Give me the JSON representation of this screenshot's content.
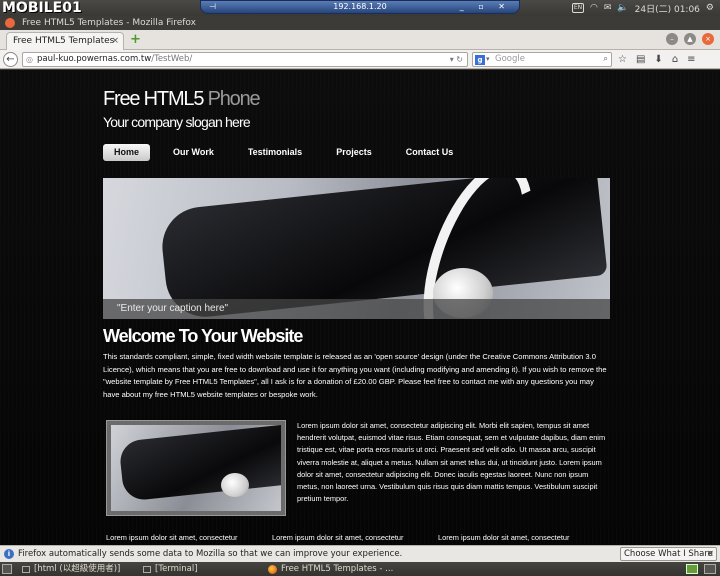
{
  "top_panel": {
    "brand": "MOBILE01",
    "vnc_address": "192.168.1.20",
    "clock": "24日(二) 01:06",
    "kb_label": "EN"
  },
  "window": {
    "title": "Free HTML5 Templates - Mozilla Firefox"
  },
  "tabs": [
    {
      "label": "Free HTML5 Templates",
      "close": "×"
    }
  ],
  "new_tab_label": "+",
  "nav": {
    "url_host": "paul-kuo.powernas.com.tw",
    "url_path": "/TestWeb/",
    "search_placeholder": "Google"
  },
  "site": {
    "logo_main": "Free HTML5",
    "logo_accent": " Phone",
    "slogan": "Your company slogan here",
    "menu": [
      {
        "label": "Home",
        "active": true
      },
      {
        "label": "Our Work",
        "active": false
      },
      {
        "label": "Testimonials",
        "active": false
      },
      {
        "label": "Projects",
        "active": false
      },
      {
        "label": "Contact Us",
        "active": false
      }
    ],
    "banner_caption": "\"Enter your caption here\"",
    "welcome_title": "Welcome To Your Website",
    "intro_text": "This standards compliant, simple, fixed width website template is released as an 'open source' design (under the Creative Commons Attribution 3.0 Licence), which means that you are free to download and use it for anything you want (including modifying and amending it). If you wish to remove the \"website template by Free HTML5 Templates\", all I ask is for a donation of £20.00 GBP. Please feel free to contact me with any questions you may have about my free HTML5 website templates or bespoke work.",
    "side_text": "Lorem ipsum dolor sit amet, consectetur adipiscing elit. Morbi elit sapien, tempus sit amet hendrerit volutpat, euismod vitae risus. Etiam consequat, sem et vulputate dapibus, diam enim tristique est, vitae porta eros mauris ut orci. Praesent sed velit odio. Ut massa arcu, suscipit viverra molestie at, aliquet a metus. Nullam sit amet tellus dui, ut tincidunt justo. Lorem ipsum dolor sit amet, consectetur adipiscing elit. Donec iaculis egestas laoreet. Nunc non ipsum metus, non laoreet urna. Vestibulum quis risus quis diam mattis tempus. Vestibulum suscipit pretium tempor.",
    "columns": [
      "Lorem ipsum dolor sit amet, consectetur",
      "Lorem ipsum dolor sit amet, consectetur",
      "Lorem ipsum dolor sit amet, consectetur"
    ]
  },
  "notification": {
    "message": "Firefox automatically sends some data to Mozilla so that we can improve your experience.",
    "button": "Choose What I Share",
    "close": "×"
  },
  "taskbar": {
    "items": [
      "[html (以超級使用者)]",
      "[Terminal]",
      "Free HTML5 Templates - ..."
    ]
  },
  "colors": {
    "page_bg": "#070707",
    "vnc_bar": "#27457c",
    "ubuntu_orange": "#e9693d"
  }
}
